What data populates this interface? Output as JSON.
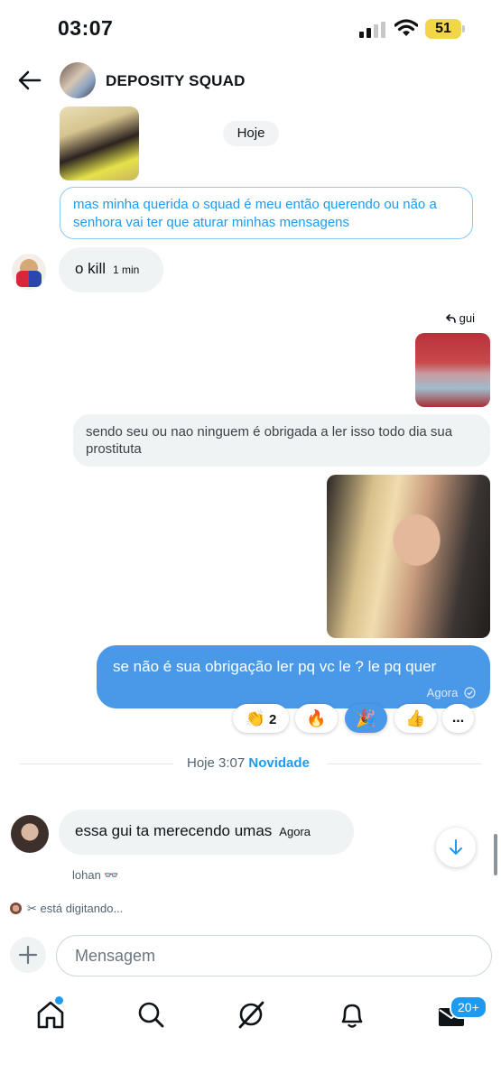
{
  "status_bar": {
    "time": "03:07",
    "battery": "51"
  },
  "header": {
    "group_name": "DEPOSITY SQUAD"
  },
  "date_chip": "Hoje",
  "messages": {
    "quoted_reply": "mas minha querida o squad é meu então querendo ou não a senhora vai ter que aturar minhas mensagens",
    "kill": {
      "text": "o kill",
      "time": "1 min"
    },
    "reply_to": "gui",
    "quoted_own": "sendo seu ou nao ninguem é obrigada a ler isso todo dia sua prostituta",
    "own": {
      "text": "se não é sua obrigação ler pq vc le ? le pq quer",
      "time": "Agora"
    },
    "last": {
      "text": "essa gui ta merecendo umas",
      "time": "Agora"
    }
  },
  "reactions": [
    {
      "emoji": "👏",
      "count": "2"
    },
    {
      "emoji": "🔥"
    },
    {
      "emoji": "🎉"
    },
    {
      "emoji": "👍"
    },
    {
      "label": "..."
    }
  ],
  "divider": {
    "time": "Hoje 3:07",
    "new_label": "Novidade"
  },
  "seen": "lohan 👓",
  "typing": "✂ está digitando...",
  "composer": {
    "placeholder": "Mensagem"
  },
  "tabbar": {
    "messages_badge": "20+"
  },
  "icons": [
    "back-arrow-icon",
    "home-icon",
    "search-icon",
    "grok-icon",
    "bell-icon",
    "mail-icon",
    "plus-icon",
    "arrow-down-icon",
    "reply-icon",
    "check-icon"
  ]
}
